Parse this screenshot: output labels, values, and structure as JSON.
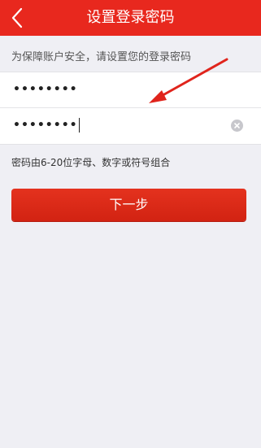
{
  "header": {
    "title": "设置登录密码",
    "back_icon": "chevron-left-icon"
  },
  "tip": "为保障账户安全，请设置您的登录密码",
  "fields": [
    {
      "value": "••••••••"
    },
    {
      "value": "••••••••"
    }
  ],
  "rule": "密码由6-20位字母、数字或符号组合",
  "next_button": "下一步",
  "colors": {
    "brand_red": "#e8281e",
    "background": "#efeff4",
    "annotation_red": "#e0241c"
  }
}
